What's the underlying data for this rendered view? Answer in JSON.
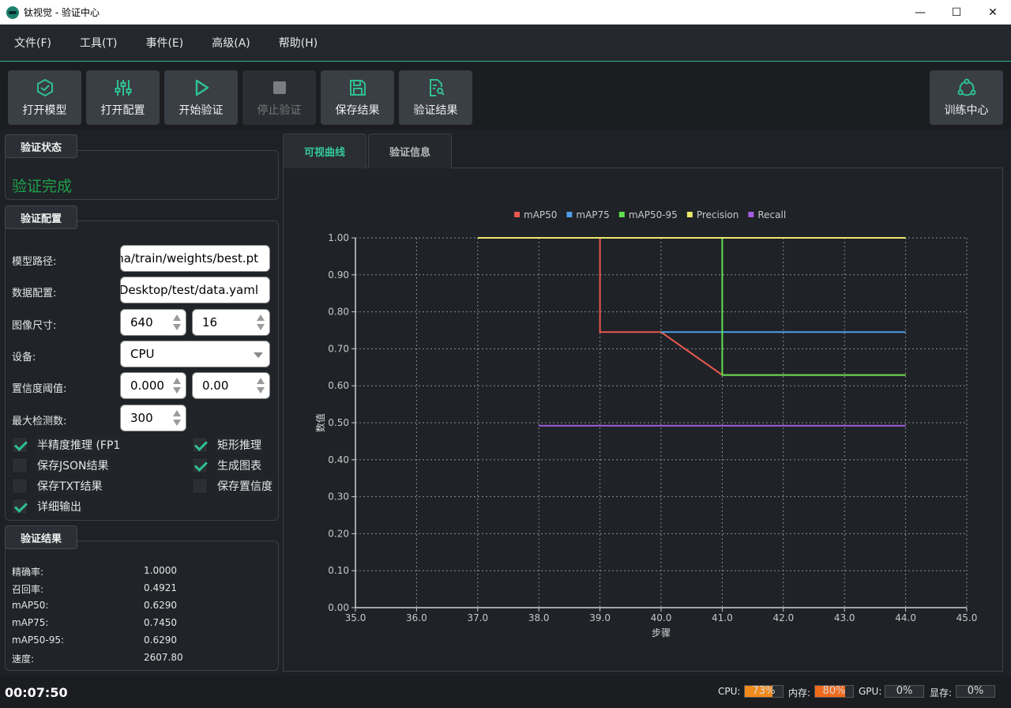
{
  "window": {
    "title": "钛视觉 - 验证中心",
    "minimize": "—",
    "maximize": "☐",
    "close": "✕"
  },
  "menu": [
    "文件(F)",
    "工具(T)",
    "事件(E)",
    "高级(A)",
    "帮助(H)"
  ],
  "toolbar": {
    "open_model": "打开模型",
    "open_config": "打开配置",
    "start_validation": "开始验证",
    "stop_validation": "停止验证",
    "save_results": "保存结果",
    "validation_results": "验证结果",
    "training_center": "训练中心"
  },
  "status_group": {
    "title": "验证状态",
    "status": "验证完成"
  },
  "config_group": {
    "title": "验证配置",
    "model_path_label": "模型路径:",
    "model_path": "na/train/weights/best.pt",
    "data_config_label": "数据配置:",
    "data_config": "/Desktop/test/data.yaml",
    "image_size_label": "图像尺寸:",
    "image_size": "640",
    "batch_size": "16",
    "device_label": "设备:",
    "device": "CPU",
    "conf_label": "置信度阈值:",
    "conf": "0.000",
    "iou": "0.00",
    "max_det_label": "最大检测数:",
    "max_det": "300",
    "checks": [
      {
        "label": "半精度推理 (FP1",
        "checked": true
      },
      {
        "label": "矩形推理",
        "checked": true
      },
      {
        "label": "保存JSON结果",
        "checked": false
      },
      {
        "label": "生成图表",
        "checked": true
      },
      {
        "label": "保存TXT结果",
        "checked": false
      },
      {
        "label": "保存置信度",
        "checked": false
      },
      {
        "label": "详细输出",
        "checked": true
      }
    ]
  },
  "results_group": {
    "title": "验证结果",
    "rows": [
      {
        "label": "精确率:",
        "value": "1.0000"
      },
      {
        "label": "召回率:",
        "value": "0.4921"
      },
      {
        "label": "mAP50:",
        "value": "0.6290"
      },
      {
        "label": "mAP75:",
        "value": "0.7450"
      },
      {
        "label": "mAP50-95:",
        "value": "0.6290"
      },
      {
        "label": "速度:",
        "value": "2607.80"
      }
    ]
  },
  "tabs": {
    "curves": "可视曲线",
    "info": "验证信息"
  },
  "chart_data": {
    "type": "line",
    "xlabel": "步骤",
    "ylabel": "数值",
    "xlim": [
      35.0,
      45.0
    ],
    "ylim": [
      0.0,
      1.0
    ],
    "xticks": [
      "35.0",
      "36.0",
      "37.0",
      "38.0",
      "39.0",
      "40.0",
      "41.0",
      "42.0",
      "43.0",
      "44.0",
      "45.0"
    ],
    "yticks": [
      "0.00",
      "0.10",
      "0.20",
      "0.30",
      "0.40",
      "0.50",
      "0.60",
      "0.70",
      "0.80",
      "0.90",
      "1.00"
    ],
    "grid": true,
    "legend_position": "top",
    "series": [
      {
        "name": "mAP50",
        "color": "#e8584f",
        "points": [
          [
            39.0,
            1.0
          ],
          [
            39.0,
            0.745
          ],
          [
            40.0,
            0.745
          ],
          [
            41.0,
            0.629
          ],
          [
            44.0,
            0.629
          ]
        ]
      },
      {
        "name": "mAP75",
        "color": "#4f9be8",
        "points": [
          [
            40.0,
            0.745
          ],
          [
            44.0,
            0.745
          ]
        ]
      },
      {
        "name": "mAP50-95",
        "color": "#5fe04f",
        "points": [
          [
            41.0,
            1.0
          ],
          [
            41.0,
            0.629
          ],
          [
            44.0,
            0.629
          ]
        ]
      },
      {
        "name": "Precision",
        "color": "#ece86a",
        "points": [
          [
            37.0,
            1.0
          ],
          [
            44.0,
            1.0
          ]
        ]
      },
      {
        "name": "Recall",
        "color": "#a25ce0",
        "points": [
          [
            38.0,
            0.4921
          ],
          [
            44.0,
            0.4921
          ]
        ]
      }
    ]
  },
  "statusbar": {
    "elapsed": "00:07:50",
    "cpu_label": "CPU:",
    "cpu_value": "73%",
    "cpu_percent": 73,
    "mem_label": "内存:",
    "mem_value": "80%",
    "mem_percent": 80,
    "gpu_label": "GPU:",
    "gpu_value": "0%",
    "vram_label": "显存:",
    "vram_value": "0%"
  }
}
